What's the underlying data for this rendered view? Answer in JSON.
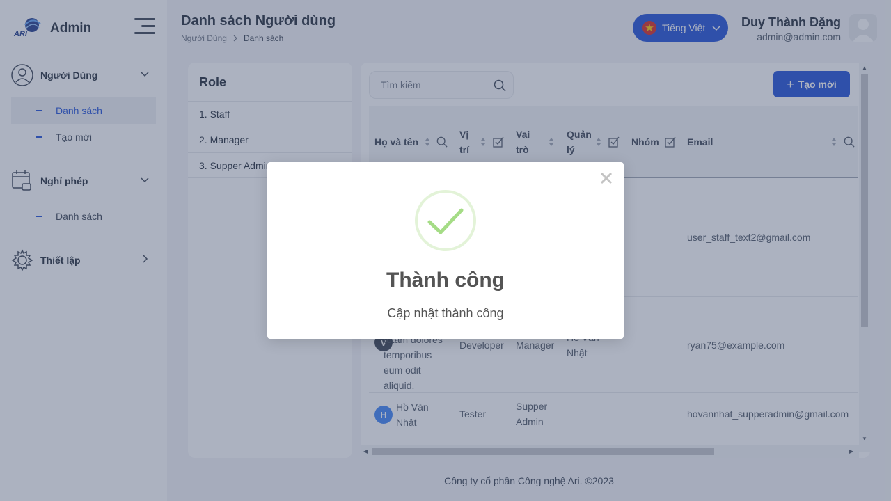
{
  "sidebar": {
    "brand": "Admin",
    "logo_text": "ARI",
    "groups": [
      {
        "label": "Người Dùng",
        "items": [
          {
            "label": "Danh sách"
          },
          {
            "label": "Tạo mới"
          }
        ]
      },
      {
        "label": "Nghỉ phép",
        "items": [
          {
            "label": "Danh sách"
          }
        ]
      },
      {
        "label": "Thiết lập",
        "items": []
      }
    ]
  },
  "header": {
    "title": "Danh sách Người dùng",
    "breadcrumb": [
      "Người Dùng",
      "Danh sách"
    ],
    "language": "Tiếng Việt",
    "user_name": "Duy Thành Đặng",
    "user_email": "admin@admin.com"
  },
  "roles": {
    "title": "Role",
    "items": [
      "1. Staff",
      "2. Manager",
      "3. Supper Admin"
    ]
  },
  "table": {
    "search_placeholder": "Tìm kiếm",
    "create_label": "Tạo mới",
    "columns": {
      "name": "Họ và tên",
      "position": [
        "Vị",
        "trí"
      ],
      "role": [
        "Vai",
        "trò"
      ],
      "manager": [
        "Quản",
        "lý"
      ],
      "group": "Nhóm",
      "email": "Email"
    },
    "rows": [
      {
        "email": "user_staff_text2@gmail.com"
      },
      {
        "avatar": "V",
        "name_lines": [
          "totam dolores",
          "temporibus",
          "eum odit",
          "aliquid."
        ],
        "position": "Developer",
        "role": "Manager",
        "manager_lines": [
          "Hồ Văn",
          "Nhật"
        ],
        "email": "ryan75@example.com"
      },
      {
        "avatar": "H",
        "name_lines": [
          "Hồ Văn",
          "Nhật"
        ],
        "position": "Tester",
        "role_lines": [
          "Supper",
          "Admin"
        ],
        "email": "hovannhat_supperadmin@gmail.com"
      }
    ]
  },
  "footer": "Công ty cổ phần Công nghệ Ari. ©2023",
  "modal": {
    "title": "Thành công",
    "message": "Cập nhật thành công"
  },
  "colors": {
    "primary": "#1d4ed8",
    "success": "#a5dc86",
    "overlay": "rgba(71, 85, 115, 0.45)"
  }
}
